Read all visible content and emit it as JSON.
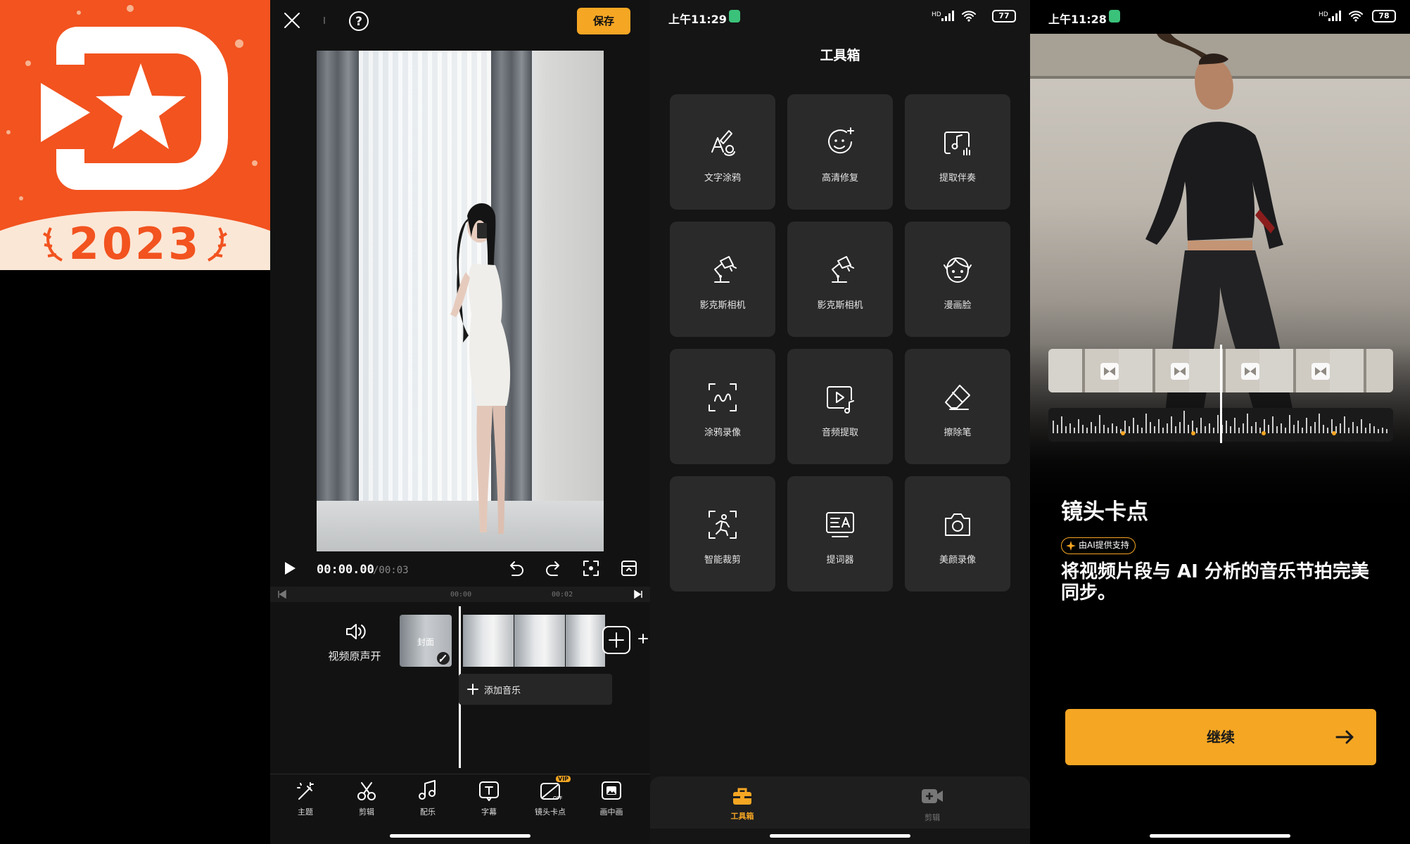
{
  "logo": {
    "year": "2023",
    "brand_color": "#f2531f",
    "bg_bottom": "#fbe7d6"
  },
  "editor": {
    "save_label": "保存",
    "time_current": "00:00.00",
    "time_total": "/00:03",
    "ruler_marks": [
      "00:00",
      "00:02"
    ],
    "sound_label": "视频原声开",
    "cover_label": "封面",
    "add_music_label": "添加音乐",
    "vip_badge": "VIP",
    "tools": [
      {
        "label": "主题",
        "icon": "magic-wand-icon"
      },
      {
        "label": "剪辑",
        "icon": "scissors-icon"
      },
      {
        "label": "配乐",
        "icon": "music-note-icon"
      },
      {
        "label": "字幕",
        "icon": "text-box-icon"
      },
      {
        "label": "镜头卡点",
        "icon": "beat-sync-off-icon"
      },
      {
        "label": "画中画",
        "icon": "picture-in-picture-icon"
      }
    ],
    "accent": "#f5a623"
  },
  "toolbox": {
    "time": "上午11:29",
    "battery": "77",
    "network": "HD",
    "title": "工具箱",
    "tiles": [
      {
        "label": "文字涂鸦",
        "icon": "text-doodle-icon"
      },
      {
        "label": "高清修复",
        "icon": "face-enhance-icon"
      },
      {
        "label": "提取伴奏",
        "icon": "extract-accompaniment-icon"
      },
      {
        "label": "影克斯相机",
        "icon": "desk-lamp-icon"
      },
      {
        "label": "影克斯相机",
        "icon": "desk-lamp-icon"
      },
      {
        "label": "漫画脸",
        "icon": "cartoon-face-icon"
      },
      {
        "label": "涂鸦录像",
        "icon": "doodle-record-icon"
      },
      {
        "label": "音频提取",
        "icon": "audio-extract-icon"
      },
      {
        "label": "擦除笔",
        "icon": "eraser-icon"
      },
      {
        "label": "智能裁剪",
        "icon": "smart-crop-icon"
      },
      {
        "label": "提词器",
        "icon": "teleprompter-icon"
      },
      {
        "label": "美颜录像",
        "icon": "beauty-camera-icon"
      }
    ],
    "nav": [
      {
        "label": "工具箱",
        "icon": "toolbox-icon",
        "active": true
      },
      {
        "label": "剪辑",
        "icon": "video-add-icon",
        "active": false
      }
    ]
  },
  "onboard": {
    "time": "上午11:28",
    "battery": "78",
    "network": "HD",
    "heading": "镜头卡点",
    "ai_badge": "由AI提供支持",
    "description": "将视频片段与 AI 分析的音乐节拍完美同步。",
    "continue_label": "继续"
  }
}
